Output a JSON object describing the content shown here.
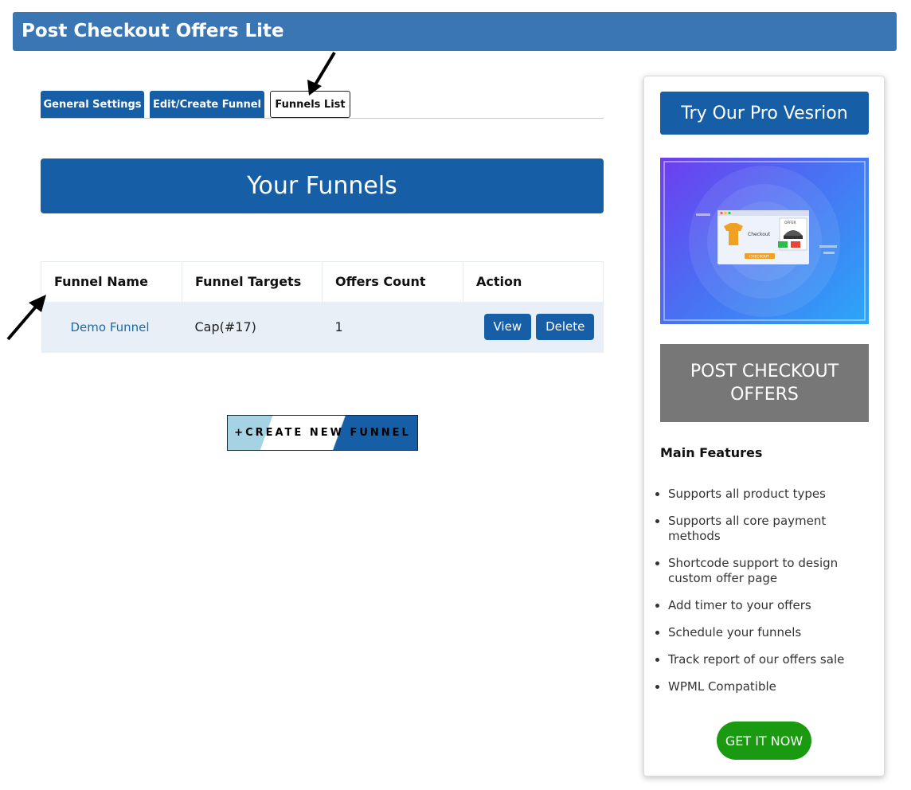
{
  "app": {
    "title": "Post Checkout Offers Lite"
  },
  "tabs": [
    {
      "label": "General Settings"
    },
    {
      "label": "Edit/Create Funnel"
    },
    {
      "label": "Funnels List"
    }
  ],
  "main": {
    "heading": "Your Funnels",
    "table": {
      "headers": [
        "Funnel Name",
        "Funnel Targets",
        "Offers Count",
        "Action"
      ],
      "rows": [
        {
          "name": "Demo Funnel",
          "targets": "Cap(#17)",
          "offers": "1",
          "view": "View",
          "delete": "Delete"
        }
      ]
    },
    "create_button": "+CREATE NEW FUNNEL"
  },
  "sidebar": {
    "pro_button": "Try Our Pro Vesrion",
    "promo_image": {
      "checkout_label": "Checkout",
      "offer_label": "OFFER",
      "checkout_button": "CHECKOUT"
    },
    "banner": "POST CHECKOUT OFFERS",
    "features_title": "Main Features",
    "features": [
      "Supports all product types",
      "Supports all core payment methods",
      "Shortcode support to design custom offer page",
      "Add timer to your offers",
      "Schedule your funnels",
      "Track report of our offers sale",
      "WPML Compatible"
    ],
    "cta": "GET IT NOW"
  },
  "colors": {
    "title_bar": "#3a76b4",
    "primary": "#165fa7",
    "banner_gray": "#777777",
    "cta_green": "#1a9a11",
    "row_bg": "#e8eff6"
  }
}
